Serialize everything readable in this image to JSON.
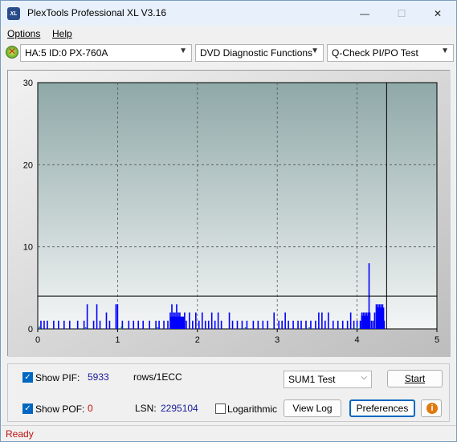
{
  "window": {
    "title": "PlexTools Professional XL V3.16",
    "icon_label": "XL",
    "controls": {
      "minimize": "—",
      "maximize": "☐",
      "close": "✕"
    }
  },
  "menu": {
    "options": "Options",
    "help": "Help"
  },
  "toolbar": {
    "drive": "HA:5 ID:0  PX-760A",
    "function": "DVD Diagnostic Functions",
    "test": "Q-Check PI/PO Test"
  },
  "chart_data": {
    "type": "bar",
    "xlabel": "",
    "ylabel": "",
    "xlim": [
      0,
      5
    ],
    "ylim": [
      0,
      30
    ],
    "x_ticks": [
      0,
      1,
      2,
      3,
      4,
      5
    ],
    "y_ticks": [
      0,
      10,
      20,
      30
    ],
    "threshold_line": 4,
    "end_marker_x": 4.37,
    "grid": true,
    "series": [
      {
        "color": "#0000ff",
        "points": [
          [
            0.04,
            1
          ],
          [
            0.08,
            1
          ],
          [
            0.12,
            1
          ],
          [
            0.2,
            1
          ],
          [
            0.26,
            1
          ],
          [
            0.33,
            1
          ],
          [
            0.4,
            1
          ],
          [
            0.5,
            1
          ],
          [
            0.58,
            1
          ],
          [
            0.62,
            3
          ],
          [
            0.7,
            1
          ],
          [
            0.74,
            3
          ],
          [
            0.78,
            1
          ],
          [
            0.86,
            2
          ],
          [
            0.9,
            1
          ],
          [
            0.98,
            3
          ],
          [
            1.0,
            3
          ],
          [
            1.06,
            1
          ],
          [
            1.14,
            1
          ],
          [
            1.2,
            1
          ],
          [
            1.26,
            1
          ],
          [
            1.32,
            1
          ],
          [
            1.4,
            1
          ],
          [
            1.48,
            1
          ],
          [
            1.52,
            1
          ],
          [
            1.58,
            1
          ],
          [
            1.63,
            1
          ],
          [
            1.66,
            2
          ],
          [
            1.68,
            3
          ],
          [
            1.7,
            2
          ],
          [
            1.72,
            2
          ],
          [
            1.74,
            3
          ],
          [
            1.76,
            2
          ],
          [
            1.78,
            2
          ],
          [
            1.8,
            1
          ],
          [
            1.84,
            2
          ],
          [
            1.86,
            1
          ],
          [
            1.9,
            2
          ],
          [
            1.94,
            1
          ],
          [
            1.98,
            2
          ],
          [
            2.02,
            1
          ],
          [
            2.06,
            2
          ],
          [
            2.1,
            1
          ],
          [
            2.14,
            1
          ],
          [
            2.18,
            2
          ],
          [
            2.22,
            1
          ],
          [
            2.26,
            2
          ],
          [
            2.3,
            1
          ],
          [
            2.4,
            2
          ],
          [
            2.44,
            1
          ],
          [
            2.5,
            1
          ],
          [
            2.56,
            1
          ],
          [
            2.62,
            1
          ],
          [
            2.7,
            1
          ],
          [
            2.76,
            1
          ],
          [
            2.82,
            1
          ],
          [
            2.88,
            1
          ],
          [
            2.96,
            2
          ],
          [
            3.02,
            1
          ],
          [
            3.06,
            1
          ],
          [
            3.1,
            2
          ],
          [
            3.14,
            1
          ],
          [
            3.2,
            1
          ],
          [
            3.26,
            1
          ],
          [
            3.3,
            1
          ],
          [
            3.36,
            1
          ],
          [
            3.42,
            1
          ],
          [
            3.48,
            1
          ],
          [
            3.52,
            2
          ],
          [
            3.56,
            2
          ],
          [
            3.6,
            1
          ],
          [
            3.64,
            2
          ],
          [
            3.7,
            1
          ],
          [
            3.76,
            1
          ],
          [
            3.82,
            1
          ],
          [
            3.88,
            1
          ],
          [
            3.92,
            2
          ],
          [
            3.96,
            1
          ],
          [
            4.0,
            1
          ],
          [
            4.04,
            1
          ],
          [
            4.06,
            2
          ],
          [
            4.08,
            2
          ],
          [
            4.1,
            2
          ],
          [
            4.12,
            2
          ],
          [
            4.14,
            2
          ],
          [
            4.15,
            8
          ],
          [
            4.16,
            2
          ],
          [
            4.18,
            1
          ],
          [
            4.2,
            1
          ],
          [
            4.22,
            2
          ],
          [
            4.24,
            3
          ],
          [
            4.26,
            3
          ],
          [
            4.28,
            3
          ],
          [
            4.3,
            3
          ],
          [
            4.32,
            3
          ],
          [
            4.34,
            1
          ]
        ]
      },
      {
        "color": "#008080",
        "points": [
          [
            0.02,
            0.3
          ],
          [
            0.6,
            0.2
          ],
          [
            1.05,
            0.3
          ],
          [
            1.5,
            0.2
          ],
          [
            2.6,
            0.2
          ],
          [
            3.4,
            0.2
          ],
          [
            4.0,
            0.3
          ]
        ]
      }
    ]
  },
  "bottom": {
    "show_pif_label": "Show PIF:",
    "pif_value": "5933",
    "rows_unit": "rows/1ECC",
    "test_select": "SUM1 Test",
    "start_button": "Start",
    "show_pof_label": "Show POF:",
    "pof_value": "0",
    "lsn_label": "LSN:",
    "lsn_value": "2295104",
    "logarithmic_label": "Logarithmic",
    "view_log_button": "View Log",
    "preferences_button": "Preferences",
    "info_icon": "i"
  },
  "status": {
    "text": "Ready"
  },
  "colors": {
    "accent": "#0067c0",
    "chart_bar": "#0000ff",
    "status_text": "#c01010"
  }
}
